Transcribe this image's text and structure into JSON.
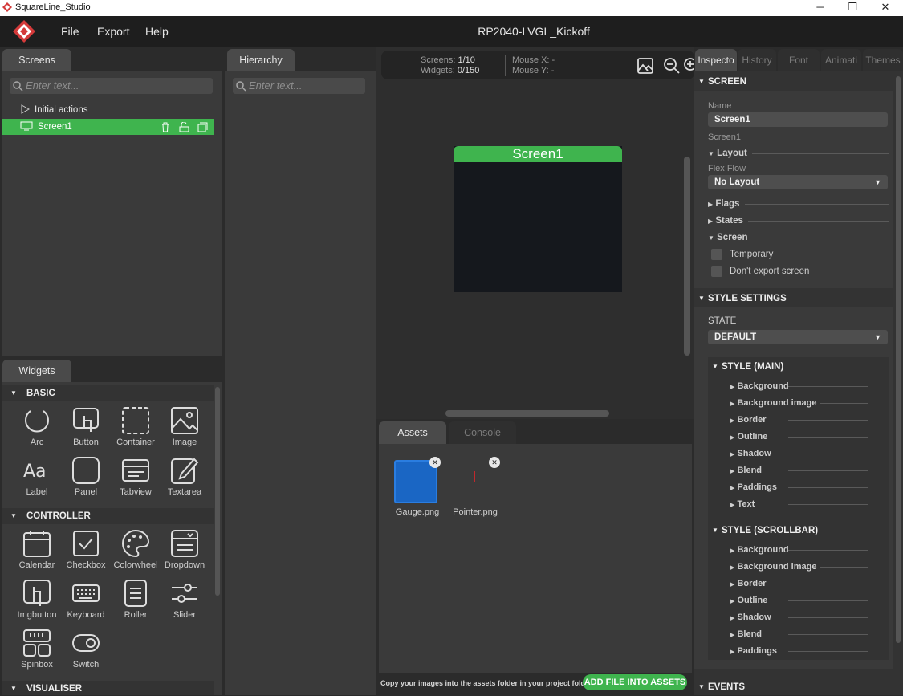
{
  "window": {
    "title": "SquareLine_Studio",
    "min": "─",
    "max": "❐",
    "close": "✕"
  },
  "menu": {
    "file": "File",
    "export": "Export",
    "help": "Help",
    "project": "RP2040-LVGL_Kickoff"
  },
  "screens_panel": {
    "tab": "Screens",
    "search_placeholder": "Enter text...",
    "initial_actions": "Initial actions",
    "screen_item": "Screen1"
  },
  "hierarchy_panel": {
    "tab": "Hierarchy",
    "search_placeholder": "Enter text..."
  },
  "widgets_panel": {
    "tab": "Widgets",
    "basic": {
      "title": "BASIC",
      "items": [
        "Arc",
        "Button",
        "Container",
        "Image",
        "Label",
        "Panel",
        "Tabview",
        "Textarea"
      ]
    },
    "controller": {
      "title": "CONTROLLER",
      "items": [
        "Calendar",
        "Checkbox",
        "Colorwheel",
        "Dropdown",
        "Imgbutton",
        "Keyboard",
        "Roller",
        "Slider",
        "Spinbox",
        "Switch"
      ]
    },
    "visualiser": {
      "title": "VISUALISER"
    }
  },
  "canvas": {
    "screens_label": "Screens:",
    "screens_value": "1/10",
    "widgets_label": "Widgets:",
    "widgets_value": "0/150",
    "mouse_x": "Mouse X: -",
    "mouse_y": "Mouse Y: -",
    "screen_title": "Screen1"
  },
  "assets": {
    "tab_assets": "Assets",
    "tab_console": "Console",
    "files": [
      "Gauge.png",
      "Pointer.png"
    ],
    "hint": "Copy your images into the assets folder in your project folder",
    "add_button": "ADD FILE INTO ASSETS"
  },
  "inspector": {
    "tabs": [
      "Inspecto",
      "History",
      "Font",
      "Animati",
      "Themes"
    ],
    "screen_section": "SCREEN",
    "name_label": "Name",
    "name_value": "Screen1",
    "screen_sub": "Screen1",
    "layout": "Layout",
    "flex_flow": "Flex Flow",
    "flex_value": "No Layout",
    "flags": "Flags",
    "states": "States",
    "screen": "Screen",
    "temporary": "Temporary",
    "dont_export": "Don't export screen",
    "style_settings": "STYLE SETTINGS",
    "state_label": "STATE",
    "state_value": "DEFAULT",
    "style_main": "STYLE (MAIN)",
    "main_items": [
      "Background",
      "Background image",
      "Border",
      "Outline",
      "Shadow",
      "Blend",
      "Paddings",
      "Text"
    ],
    "style_scrollbar": "STYLE (SCROLLBAR)",
    "scroll_items": [
      "Background",
      "Background image",
      "Border",
      "Outline",
      "Shadow",
      "Blend",
      "Paddings"
    ],
    "events": "EVENTS"
  },
  "colors": {
    "accent": "#3fb44e",
    "bg": "#2b2b2b",
    "panel": "#3a3a3a"
  }
}
